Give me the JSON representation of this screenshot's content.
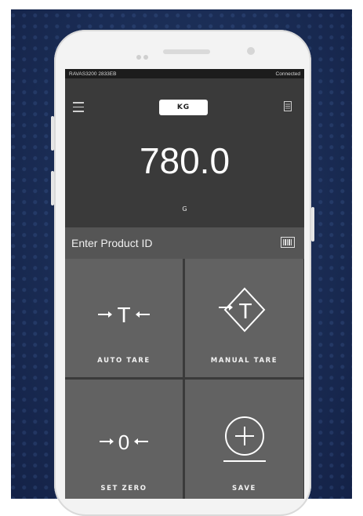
{
  "status_bar": {
    "device": "RAVAS3200 2833EB",
    "connection": "Connected"
  },
  "header": {
    "unit_button": "KG"
  },
  "weight": {
    "value": "780.0",
    "unit": "G"
  },
  "product": {
    "placeholder": "Enter Product ID"
  },
  "actions": [
    {
      "label": "AUTO TARE",
      "icon": "auto-tare-icon"
    },
    {
      "label": "MANUAL TARE",
      "icon": "manual-tare-icon"
    },
    {
      "label": "SET ZERO",
      "icon": "set-zero-icon"
    },
    {
      "label": "SAVE",
      "icon": "save-plus-icon"
    }
  ],
  "colors": {
    "background": "#1a2c54",
    "weight_panel": "#3a3a3a",
    "tile": "#626262",
    "product_row": "#555555"
  }
}
